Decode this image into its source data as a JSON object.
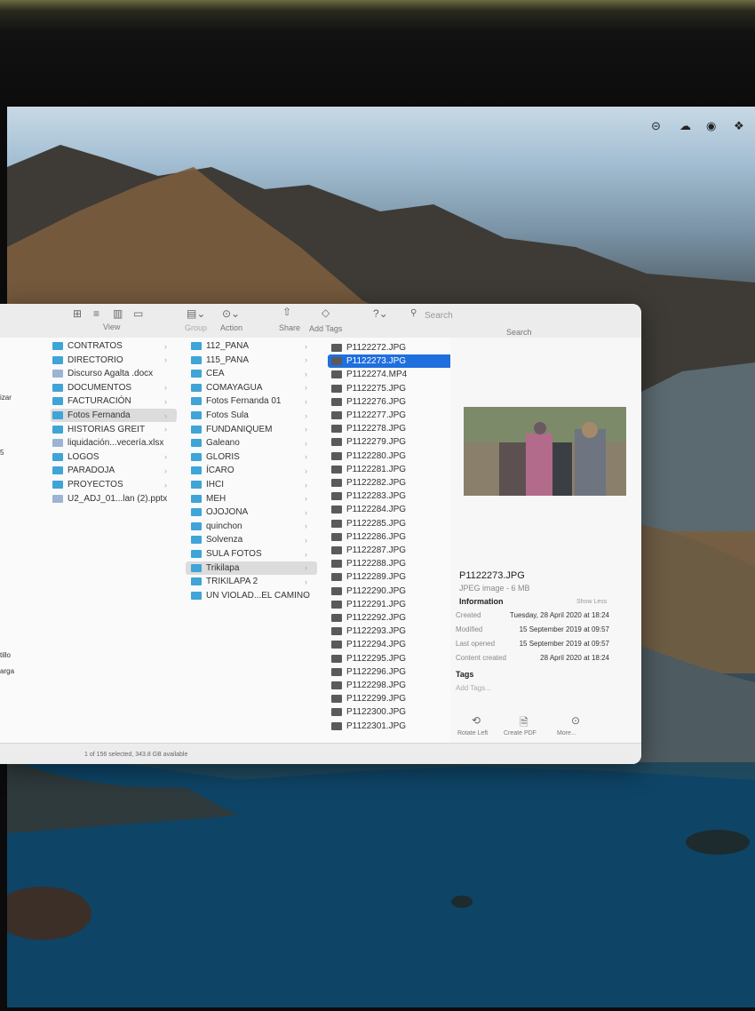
{
  "menubar": {
    "icons": [
      "remote-desktop-icon",
      "cloud-icon",
      "screen-record-icon",
      "dropbox-icon"
    ]
  },
  "toolbar": {
    "view_label": "View",
    "group_label": "Group",
    "action_label": "Action",
    "share_label": "Share",
    "add_tags_label": "Add Tags",
    "search_placeholder": "Search",
    "search_label": "Search"
  },
  "column0": {
    "items": [
      "izar",
      "5",
      "tillo",
      "arga"
    ]
  },
  "column1": {
    "items": [
      {
        "label": "CONTRATOS",
        "type": "folder",
        "chevron": true
      },
      {
        "label": "DIRECTORIO",
        "type": "folder",
        "chevron": true
      },
      {
        "label": "Discurso Agalta .docx",
        "type": "doc",
        "chevron": false
      },
      {
        "label": "DOCUMENTOS",
        "type": "folder",
        "chevron": true
      },
      {
        "label": "FACTURACIÓN",
        "type": "folder",
        "chevron": true
      },
      {
        "label": "Fotos Fernanda",
        "type": "folder",
        "chevron": true,
        "selected": true
      },
      {
        "label": "HISTORIAS GREIT",
        "type": "folder",
        "chevron": true
      },
      {
        "label": "liquidación...vecería.xlsx",
        "type": "doc",
        "chevron": false
      },
      {
        "label": "LOGOS",
        "type": "folder",
        "chevron": true
      },
      {
        "label": "PARADOJA",
        "type": "folder",
        "chevron": true
      },
      {
        "label": "PROYECTOS",
        "type": "folder",
        "chevron": true
      },
      {
        "label": "U2_ADJ_01...lan (2).pptx",
        "type": "doc",
        "chevron": false
      }
    ]
  },
  "column2": {
    "items": [
      {
        "label": "112_PANA",
        "selected": false
      },
      {
        "label": "115_PANA",
        "selected": false
      },
      {
        "label": "CEA",
        "selected": false
      },
      {
        "label": "COMAYAGUA",
        "selected": false
      },
      {
        "label": "Fotos Fernanda 01",
        "selected": false
      },
      {
        "label": "Fotos Sula",
        "selected": false
      },
      {
        "label": "FUNDANIQUEM",
        "selected": false
      },
      {
        "label": "Galeano",
        "selected": false
      },
      {
        "label": "GLORIS",
        "selected": false
      },
      {
        "label": "ÍCARO",
        "selected": false
      },
      {
        "label": "IHCI",
        "selected": false
      },
      {
        "label": "MEH",
        "selected": false
      },
      {
        "label": "OJOJONA",
        "selected": false
      },
      {
        "label": "quinchon",
        "selected": false
      },
      {
        "label": "Solvenza",
        "selected": false
      },
      {
        "label": "SULA FOTOS",
        "selected": false
      },
      {
        "label": "Trikilapa",
        "selected": true
      },
      {
        "label": "TRIKILAPA 2",
        "selected": false
      },
      {
        "label": "UN VIOLAD...EL CAMINO",
        "selected": false
      }
    ]
  },
  "column3": {
    "items": [
      "P1122272.JPG",
      "P1122273.JPG",
      "P1122274.MP4",
      "P1122275.JPG",
      "P1122276.JPG",
      "P1122277.JPG",
      "P1122278.JPG",
      "P1122279.JPG",
      "P1122280.JPG",
      "P1122281.JPG",
      "P1122282.JPG",
      "P1122283.JPG",
      "P1122284.JPG",
      "P1122285.JPG",
      "P1122286.JPG",
      "P1122287.JPG",
      "P1122288.JPG",
      "P1122289.JPG",
      "P1122290.JPG",
      "P1122291.JPG",
      "P1122292.JPG",
      "P1122293.JPG",
      "P1122294.JPG",
      "P1122295.JPG",
      "P1122296.JPG",
      "P1122298.JPG",
      "P1122299.JPG",
      "P1122300.JPG",
      "P1122301.JPG"
    ],
    "selected_index": 1
  },
  "preview": {
    "filename": "P1122273.JPG",
    "kind": "JPEG image - 6 MB",
    "information_label": "Information",
    "show_less": "Show Less",
    "rows": [
      {
        "label": "Created",
        "value": "Tuesday, 28 April 2020 at 18:24"
      },
      {
        "label": "Modified",
        "value": "15 September 2019 at 09:57"
      },
      {
        "label": "Last opened",
        "value": "15 September 2019 at 09:57"
      },
      {
        "label": "Content created",
        "value": "28 April 2020 at 18:24"
      }
    ],
    "tags_label": "Tags",
    "add_tags_placeholder": "Add Tags...",
    "actions": [
      "Rotate Left",
      "Create PDF",
      "More..."
    ]
  },
  "status": {
    "text": "1 of 156 selected, 343.8 GB available"
  },
  "colors": {
    "selection_blue": "#1f6fde",
    "folder_blue": "#3fa4d6"
  }
}
